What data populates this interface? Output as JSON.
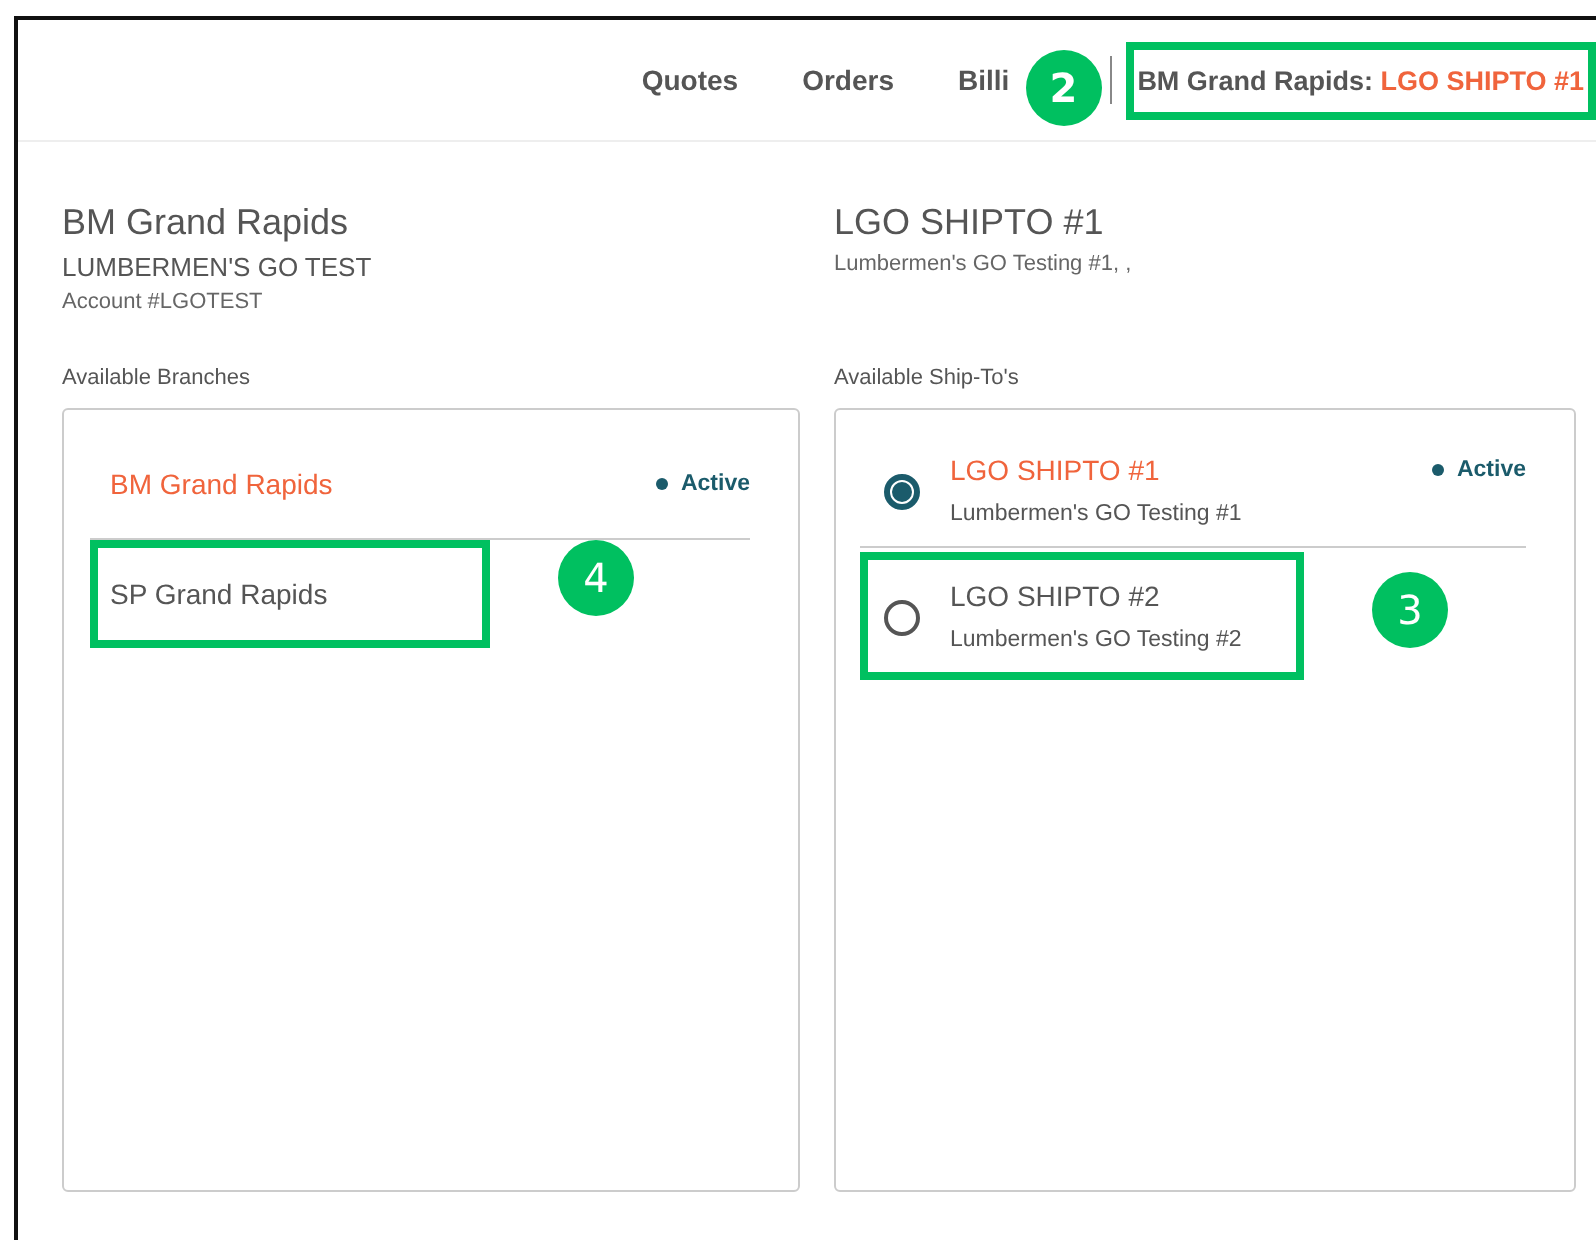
{
  "nav": {
    "items": [
      {
        "label": "Quotes"
      },
      {
        "label": "Orders"
      },
      {
        "label": "Billi"
      }
    ],
    "location": {
      "branch": "BM Grand Rapids:",
      "shipto": "LGO SHIPTO #1",
      "highlighted": true,
      "callout": "2"
    }
  },
  "branch_header": {
    "name": "BM Grand Rapids",
    "company": "LUMBERMEN'S GO TEST",
    "account": "Account #LGOTEST"
  },
  "shipto_header": {
    "name": "LGO SHIPTO #1",
    "address": "Lumbermen's GO Testing #1, ,"
  },
  "branches": {
    "label": "Available Branches",
    "items": [
      {
        "name": "BM Grand Rapids",
        "selected": true,
        "status": "Active",
        "highlighted": false
      },
      {
        "name": "SP Grand Rapids",
        "selected": false,
        "highlighted": true,
        "callout": "4"
      }
    ]
  },
  "shiptos": {
    "label": "Available Ship-To's",
    "items": [
      {
        "name": "LGO SHIPTO #1",
        "address": "Lumbermen's GO Testing #1",
        "selected": true,
        "status": "Active",
        "highlighted": false
      },
      {
        "name": "LGO SHIPTO #2",
        "address": "Lumbermen's GO Testing #2",
        "selected": false,
        "highlighted": true,
        "callout": "3"
      }
    ]
  }
}
